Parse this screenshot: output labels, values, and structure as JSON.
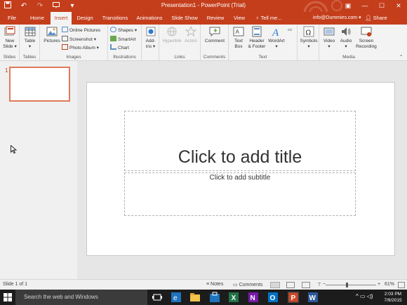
{
  "titlebar": {
    "title": "Presentation1 - PowerPoint (Trial)",
    "qat_icons": [
      "save-icon",
      "undo-icon",
      "redo-icon",
      "start-from-beginning-icon",
      "customize-qat-icon"
    ],
    "window_controls": [
      "ribbon-display-options-icon",
      "minimize-icon",
      "maximize-icon",
      "close-icon"
    ]
  },
  "tabs": [
    "File",
    "Home",
    "Insert",
    "Design",
    "Transitions",
    "Animations",
    "Slide Show",
    "Review",
    "View"
  ],
  "active_tab": "Insert",
  "tellme": "Tell me...",
  "account": "info@Dummies.com",
  "share": "Share",
  "ribbon": {
    "slides": {
      "new_slide": "New",
      "new_slide2": "Slide",
      "label": "Slides"
    },
    "tables": {
      "table": "Table",
      "label": "Tables"
    },
    "images": {
      "pictures": "Pictures",
      "online_pictures": "Online Pictures",
      "screenshot": "Screenshot",
      "photo_album": "Photo Album",
      "label": "Images"
    },
    "illustrations": {
      "shapes": "Shapes",
      "smartart": "SmartArt",
      "chart": "Chart",
      "label": "Illustrations"
    },
    "addins": {
      "addins": "Add-",
      "addins2": "ins",
      "label": ""
    },
    "links": {
      "hyperlink": "Hyperlink",
      "action": "Action",
      "label": "Links"
    },
    "comments": {
      "comment": "Comment",
      "label": "Comments"
    },
    "text": {
      "text_box": "Text",
      "text_box2": "Box",
      "header_footer": "Header",
      "header_footer2": "& Footer",
      "wordart": "WordArt",
      "label": "Text"
    },
    "symbols": {
      "symbols": "Symbols",
      "label": ""
    },
    "media": {
      "video": "Video",
      "audio": "Audio",
      "screen_recording": "Screen",
      "screen_recording2": "Recording",
      "label": "Media"
    }
  },
  "thumbnail": {
    "number": "1"
  },
  "slide": {
    "title_placeholder": "Click to add title",
    "subtitle_placeholder": "Click to add subtitle"
  },
  "statusbar": {
    "slide_info": "Slide 1 of 1",
    "notes": "Notes",
    "comments": "Comments",
    "zoom": "61%"
  },
  "taskbar": {
    "search_placeholder": "Search the web and Windows",
    "time": "2:03 PM",
    "date": "7/9/2015"
  },
  "colors": {
    "accent": "#c43e1c",
    "ribbon": "#f3f3f3",
    "taskbar": "#1c1c1c"
  }
}
